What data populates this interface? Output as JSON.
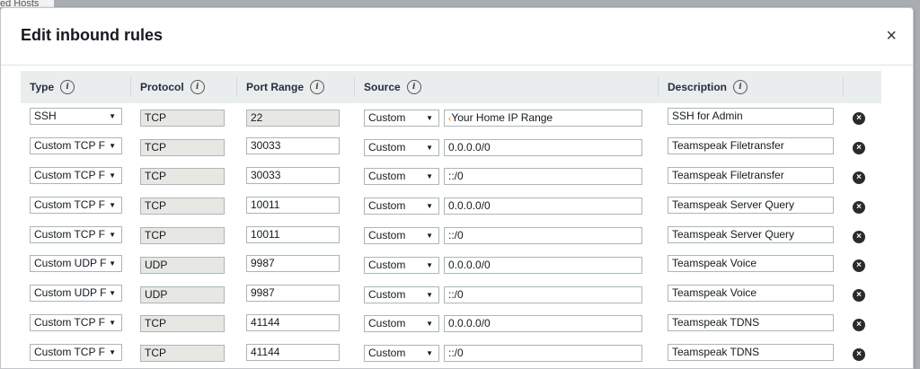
{
  "background": {
    "partial_text": "ed Hosts"
  },
  "dialog": {
    "title": "Edit inbound rules",
    "close_glyph": "×"
  },
  "columns": {
    "type": "Type",
    "protocol": "Protocol",
    "port_range": "Port Range",
    "source": "Source",
    "description": "Description",
    "info_glyph": "i"
  },
  "rows": [
    {
      "type": "SSH",
      "protocol": "TCP",
      "port": "22",
      "port_readonly": true,
      "source_type": "Custom",
      "source_value": "Your Home IP Range",
      "description": "SSH for Admin"
    },
    {
      "type": "Custom TCP F",
      "protocol": "TCP",
      "port": "30033",
      "port_readonly": false,
      "source_type": "Custom",
      "source_value": "0.0.0.0/0",
      "description": "Teamspeak Filetransfer"
    },
    {
      "type": "Custom TCP F",
      "protocol": "TCP",
      "port": "30033",
      "port_readonly": false,
      "source_type": "Custom",
      "source_value": "::/0",
      "description": "Teamspeak Filetransfer"
    },
    {
      "type": "Custom TCP F",
      "protocol": "TCP",
      "port": "10011",
      "port_readonly": false,
      "source_type": "Custom",
      "source_value": "0.0.0.0/0",
      "description": "Teamspeak Server Query"
    },
    {
      "type": "Custom TCP F",
      "protocol": "TCP",
      "port": "10011",
      "port_readonly": false,
      "source_type": "Custom",
      "source_value": "::/0",
      "description": "Teamspeak Server Query"
    },
    {
      "type": "Custom UDP F",
      "protocol": "UDP",
      "port": "9987",
      "port_readonly": false,
      "source_type": "Custom",
      "source_value": "0.0.0.0/0",
      "description": "Teamspeak Voice"
    },
    {
      "type": "Custom UDP F",
      "protocol": "UDP",
      "port": "9987",
      "port_readonly": false,
      "source_type": "Custom",
      "source_value": "::/0",
      "description": "Teamspeak Voice"
    },
    {
      "type": "Custom TCP F",
      "protocol": "TCP",
      "port": "41144",
      "port_readonly": false,
      "source_type": "Custom",
      "source_value": "0.0.0.0/0",
      "description": "Teamspeak TDNS"
    },
    {
      "type": "Custom TCP F",
      "protocol": "TCP",
      "port": "41144",
      "port_readonly": false,
      "source_type": "Custom",
      "source_value": "::/0",
      "description": "Teamspeak TDNS"
    }
  ],
  "icons": {
    "select_caret": "▼",
    "remove": "×"
  },
  "colors": {
    "header_bg": "#eaeded",
    "readonly_bg": "#e7e8e3",
    "overlay_bg": "#a9adb2"
  }
}
